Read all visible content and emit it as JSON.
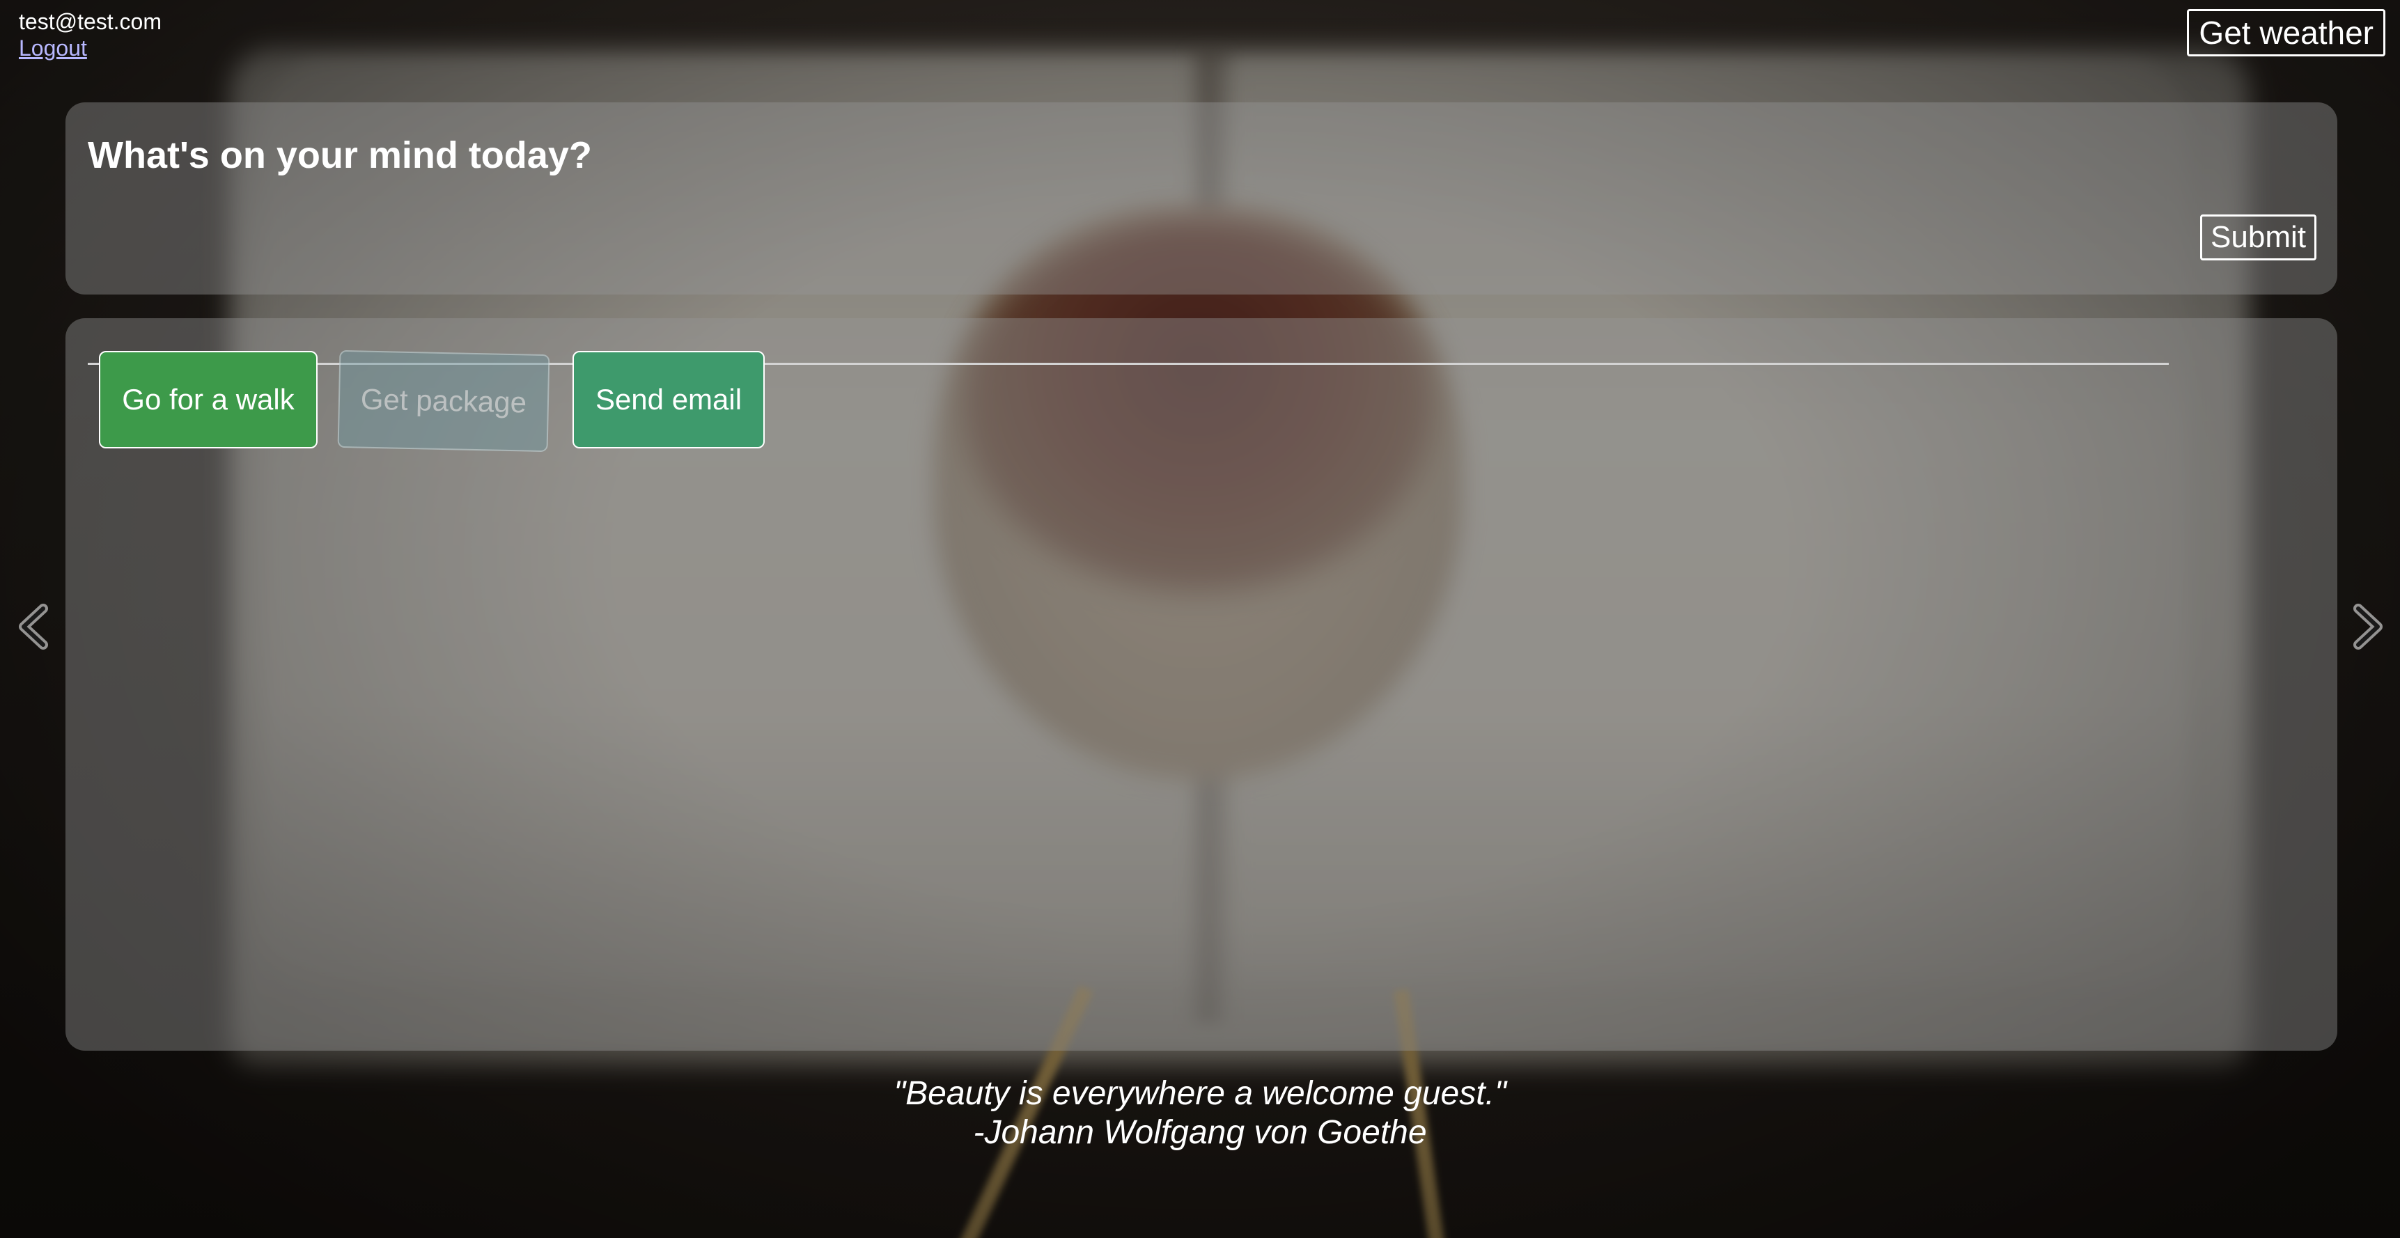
{
  "header": {
    "user_email": "test@test.com",
    "logout_label": "Logout",
    "weather_button_label": "Get weather"
  },
  "mind": {
    "title": "What's on your mind today?",
    "input_value": "",
    "submit_label": "Submit"
  },
  "tasks": [
    {
      "label": "Go for a walk",
      "color": "#3d9a4a",
      "state": "active"
    },
    {
      "label": "Get package",
      "color": "#6e96a0",
      "state": "faded"
    },
    {
      "label": "Send email",
      "color": "#3e9a6c",
      "state": "active"
    }
  ],
  "carousel": {
    "prev_icon": "chevron-left-icon",
    "next_icon": "chevron-right-icon"
  },
  "quote": {
    "text": "\"Beauty is everywhere a welcome guest.\"",
    "author": "-Johann Wolfgang von Goethe"
  }
}
